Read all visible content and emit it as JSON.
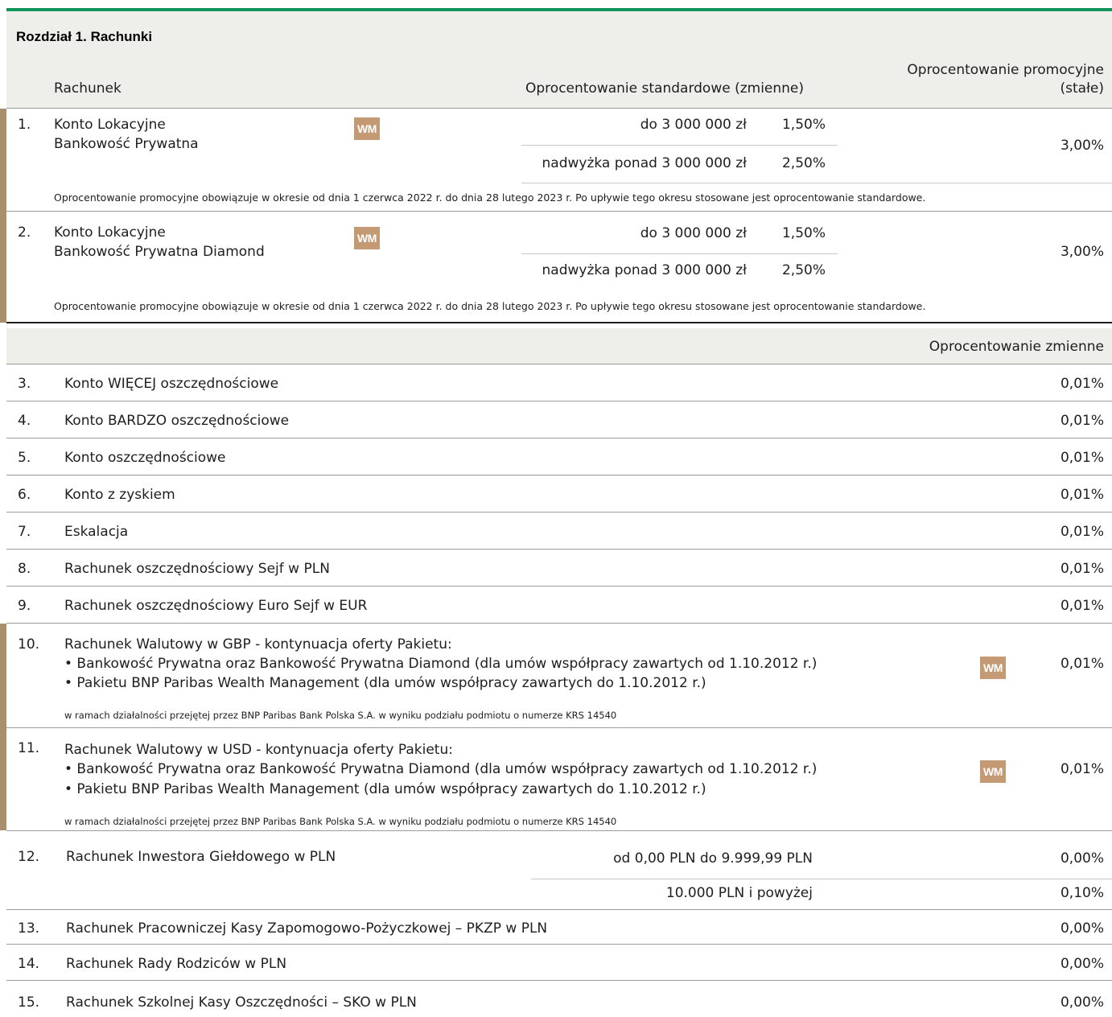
{
  "section": {
    "title": "Rozdział 1. Rachunki"
  },
  "header": {
    "col_account": "Rachunek",
    "col_standard": "Oprocentowanie standardowe (zmienne)",
    "col_promo_line1": "Oprocentowanie promocyjne",
    "col_promo_line2": "(stałe)"
  },
  "badge_label": "WM",
  "promo_rows": [
    {
      "num": "1.",
      "name_line1": "Konto Lokacyjne",
      "name_line2": "Bankowość Prywatna",
      "tier1_label": "do 3 000 000 zł",
      "tier1_rate": "1,50%",
      "tier2_label": "nadwyżka ponad 3 000 000 zł",
      "tier2_rate": "2,50%",
      "promo_rate": "3,00%",
      "note": "Oprocentowanie promocyjne obowiązuje w okresie od dnia 1 czerwca 2022 r. do dnia 28 lutego 2023 r. Po upływie tego okresu stosowane jest oprocentowanie standardowe."
    },
    {
      "num": "2.",
      "name_line1": "Konto Lokacyjne",
      "name_line2": "Bankowość Prywatna Diamond",
      "tier1_label": "do 3 000 000 zł",
      "tier1_rate": "1,50%",
      "tier2_label": "nadwyżka ponad 3 000 000 zł",
      "tier2_rate": "2,50%",
      "promo_rate": "3,00%",
      "note": "Oprocentowanie promocyjne obowiązuje w okresie od dnia 1 czerwca 2022 r. do dnia 28 lutego 2023 r. Po upływie tego okresu stosowane jest oprocentowanie standardowe."
    }
  ],
  "variable_header": "Oprocentowanie zmienne",
  "simple_rows": [
    {
      "num": "3.",
      "name": "Konto WIĘCEJ oszczędnościowe",
      "rate": "0,01%"
    },
    {
      "num": "4.",
      "name": "Konto BARDZO oszczędnościowe",
      "rate": "0,01%"
    },
    {
      "num": "5.",
      "name": "Konto oszczędnościowe",
      "rate": "0,01%"
    },
    {
      "num": "6.",
      "name": "Konto z zyskiem",
      "rate": "0,01%"
    },
    {
      "num": "7.",
      "name": "Eskalacja",
      "rate": "0,01%"
    },
    {
      "num": "8.",
      "name": "Rachunek oszczędnościowy Sejf w PLN",
      "rate": "0,01%"
    },
    {
      "num": "9.",
      "name": "Rachunek oszczędnościowy Euro Sejf w EUR",
      "rate": "0,01%"
    }
  ],
  "currency_rows": [
    {
      "num": "10.",
      "title": "Rachunek Walutowy w GBP - kontynuacja oferty Pakietu:",
      "bullet1": "• Bankowość Prywatna oraz Bankowość Prywatna Diamond (dla umów współpracy zawartych od 1.10.2012 r.)",
      "bullet2": "• Pakietu BNP Paribas Wealth Management (dla umów współpracy zawartych do 1.10.2012 r.)",
      "rate": "0,01%",
      "note": "w ramach działalności przejętej przez BNP Paribas Bank Polska S.A. w wyniku podziału podmiotu o numerze KRS 14540"
    },
    {
      "num": "11.",
      "title": "Rachunek Walutowy w USD - kontynuacja oferty Pakietu:",
      "bullet1": "• Bankowość Prywatna oraz Bankowość Prywatna Diamond (dla umów współpracy zawartych od 1.10.2012 r.)",
      "bullet2": "• Pakietu BNP Paribas Wealth Management (dla umów współpracy zawartych do 1.10.2012 r.)",
      "rate": "0,01%",
      "note": "w ramach działalności przejętej przez BNP Paribas Bank Polska S.A. w wyniku podziału podmiotu o numerze KRS 14540"
    }
  ],
  "investor_row": {
    "num": "12.",
    "name": "Rachunek Inwestora Giełdowego w PLN",
    "tier1_label": "od 0,00 PLN do 9.999,99 PLN",
    "tier1_rate": "0,00%",
    "tier2_label": "10.000 PLN i powyżej",
    "tier2_rate": "0,10%"
  },
  "final_rows": [
    {
      "num": "13.",
      "name": "Rachunek Pracowniczej Kasy Zapomogowo-Pożyczkowej – PKZP w PLN",
      "rate": "0,00%"
    },
    {
      "num": "14.",
      "name": "Rachunek Rady Rodziców w PLN",
      "rate": "0,00%"
    },
    {
      "num": "15.",
      "name": "Rachunek Szkolnej Kasy Oszczędności – SKO w PLN",
      "rate": "0,00%"
    }
  ]
}
